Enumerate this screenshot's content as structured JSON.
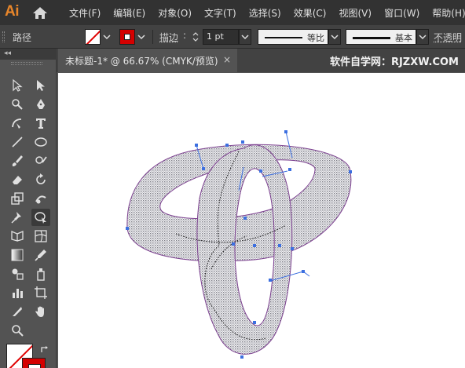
{
  "app": {
    "logo": "Ai"
  },
  "menu": [
    {
      "label": "文件(F)"
    },
    {
      "label": "编辑(E)"
    },
    {
      "label": "对象(O)"
    },
    {
      "label": "文字(T)"
    },
    {
      "label": "选择(S)"
    },
    {
      "label": "效果(C)"
    },
    {
      "label": "视图(V)"
    },
    {
      "label": "窗口(W)"
    },
    {
      "label": "帮助(H)"
    }
  ],
  "control": {
    "selection_type": "路径",
    "stroke_label": "描边",
    "stroke_weight": "1 pt",
    "profile_uniform": "等比",
    "brush_basic": "基本",
    "opacity_label": "不透明"
  },
  "document": {
    "tab_title": "未标题-1* @ 66.67% (CMYK/预览)",
    "close": "×",
    "watermark": "软件自学网：RJZXW.COM"
  },
  "colors": {
    "ui_bg": "#535353",
    "menubar": "#323232",
    "accent_logo": "#e8862a",
    "stroke_swatch": "#d40000",
    "path_stroke": "#7b3f8f",
    "anchor": "#3c6fe0"
  }
}
